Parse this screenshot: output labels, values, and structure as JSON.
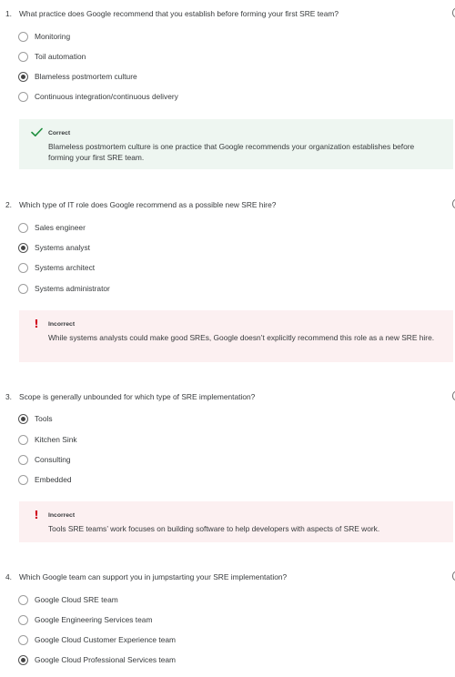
{
  "questions": [
    {
      "number": "1.",
      "text": "What practice does Google recommend that you establish before forming your first SRE team?",
      "options": [
        {
          "label": "Monitoring",
          "selected": false
        },
        {
          "label": "Toil automation",
          "selected": false
        },
        {
          "label": "Blameless postmortem culture",
          "selected": true
        },
        {
          "label": "Continuous integration/continuous delivery",
          "selected": false
        }
      ],
      "feedback": {
        "status": "Correct",
        "icon": "check-icon",
        "text": "Blameless postmortem culture is one practice that Google recommends your organization establishes before forming your first SRE team."
      }
    },
    {
      "number": "2.",
      "text": "Which type of IT role does Google recommend as a possible new SRE hire?",
      "options": [
        {
          "label": "Sales engineer",
          "selected": false
        },
        {
          "label": "Systems analyst",
          "selected": true
        },
        {
          "label": "Systems architect",
          "selected": false
        },
        {
          "label": "Systems administrator",
          "selected": false
        }
      ],
      "feedback": {
        "status": "Incorrect",
        "icon": "exclamation-icon",
        "text": "While systems analysts could make good SREs, Google doesn’t explicitly recommend this role as a new SRE hire."
      }
    },
    {
      "number": "3.",
      "text": "Scope is generally unbounded for which type of SRE implementation?",
      "options": [
        {
          "label": "Tools",
          "selected": true
        },
        {
          "label": "Kitchen Sink",
          "selected": false
        },
        {
          "label": "Consulting",
          "selected": false
        },
        {
          "label": "Embedded",
          "selected": false
        }
      ],
      "feedback": {
        "status": "Incorrect",
        "icon": "exclamation-icon",
        "text": "Tools SRE teams’ work focuses on building software to help developers with aspects of SRE work."
      }
    },
    {
      "number": "4.",
      "text": "Which Google team can support you in jumpstarting your SRE implementation?",
      "options": [
        {
          "label": "Google Cloud SRE team",
          "selected": false
        },
        {
          "label": "Google Engineering Services team",
          "selected": false
        },
        {
          "label": "Google Cloud Customer Experience team",
          "selected": false
        },
        {
          "label": "Google Cloud Professional Services team",
          "selected": true
        }
      ]
    }
  ],
  "colors": {
    "correct_bg": "#eef6f1",
    "correct_icon": "#1e8e3e",
    "incorrect_bg": "#fcf0f1",
    "incorrect_icon": "#d0021b"
  }
}
